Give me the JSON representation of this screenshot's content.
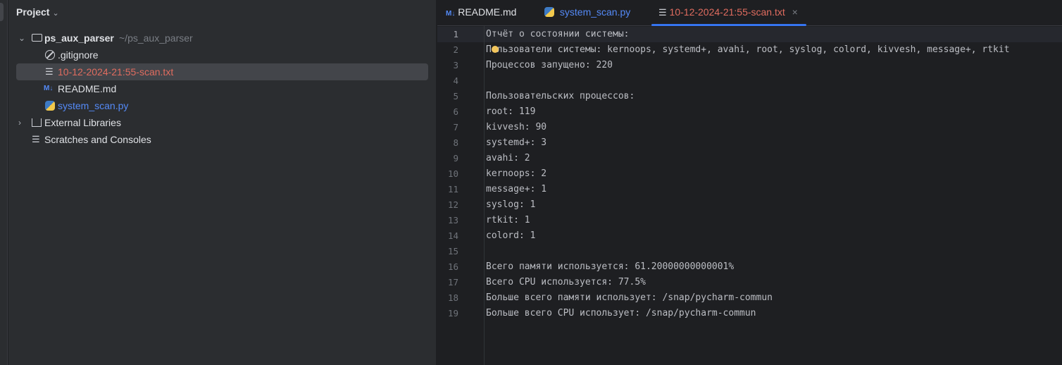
{
  "sidebar": {
    "title": "Project",
    "tree": [
      {
        "label": "ps_aux_parser",
        "hint": "~/ps_aux_parser",
        "icon": "folder-icon"
      },
      {
        "label": ".gitignore",
        "icon": "ignore-icon"
      },
      {
        "label": "10-12-2024-21:55-scan.txt",
        "icon": "text-file-icon"
      },
      {
        "label": "README.md",
        "icon": "markdown-icon",
        "badge": "M↓"
      },
      {
        "label": "system_scan.py",
        "icon": "python-icon"
      },
      {
        "label": "External Libraries",
        "icon": "library-icon"
      },
      {
        "label": "Scratches and Consoles",
        "icon": "scratches-icon"
      }
    ]
  },
  "tabs": [
    {
      "label": "README.md",
      "badge": "M↓"
    },
    {
      "label": "system_scan.py"
    },
    {
      "label": "10-12-2024-21:55-scan.txt",
      "close": "×"
    }
  ],
  "editor": {
    "lines": [
      "Отчёт о состоянии системы:",
      "Пользователи системы: kernoops, systemd+, avahi, root, syslog, colord, kivvesh, message+, rtkit",
      "Процессов запущено: 220",
      "",
      "Пользовательских процессов:",
      "root: 119",
      "kivvesh: 90",
      "systemd+: 3",
      "avahi: 2",
      "kernoops: 2",
      "message+: 1",
      "syslog: 1",
      "rtkit: 1",
      "colord: 1",
      "",
      "Всего памяти используется: 61.20000000000001%",
      "Всего CPU используется: 77.5%",
      "Больше всего памяти использует: /snap/pycharm-commun",
      "Больше всего CPU использует: /snap/pycharm-commun"
    ]
  }
}
